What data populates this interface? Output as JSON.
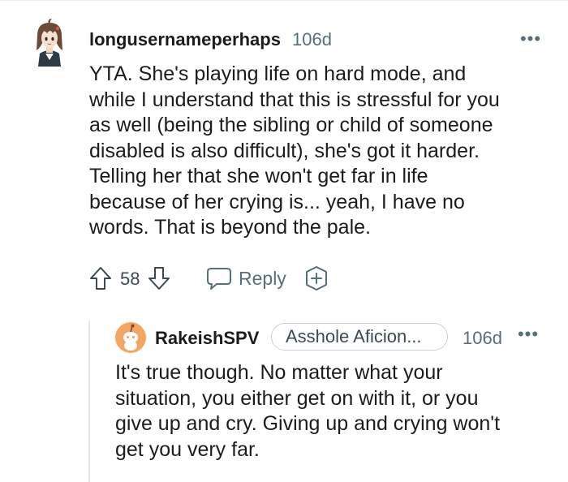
{
  "comment": {
    "avatar_icon": "anime-character-avatar-icon",
    "username": "longusernameperhaps",
    "time": "106d",
    "more_icon": "•••",
    "body_lines": [
      "YTA. She's playing life on hard mode, and",
      "while I understand that this is stressful for you",
      "as well (being the sibling or child of someone",
      "disabled is also difficult), she's got it harder.",
      "Telling her that she won't get far in life",
      "because of her crying is... yeah, I have no",
      "words. That is beyond the pale."
    ],
    "actions": {
      "upvote_icon": "arrow-up-icon",
      "vote_count": "58",
      "downvote_icon": "arrow-down-icon",
      "reply_icon": "speech-bubble-icon",
      "reply_label": "Reply",
      "award_icon": "award-plus-icon"
    }
  },
  "reply": {
    "avatar_icon": "snoo-avatar-icon",
    "username": "RakeishSPV",
    "flair": "Asshole Aficion...",
    "time": "106d",
    "more_icon": "•••",
    "body_lines": [
      "It's true though. No matter what your",
      "situation, you either get on with it, or you",
      "give up and cry. Giving up and crying won't",
      "get you very far."
    ]
  },
  "colors": {
    "text_primary": "#1c1c1c",
    "text_meta": "#576f76",
    "thread_line": "#e5e8ea",
    "flair_border": "#c9d0d3",
    "avatar_orange": "#f0a766"
  }
}
